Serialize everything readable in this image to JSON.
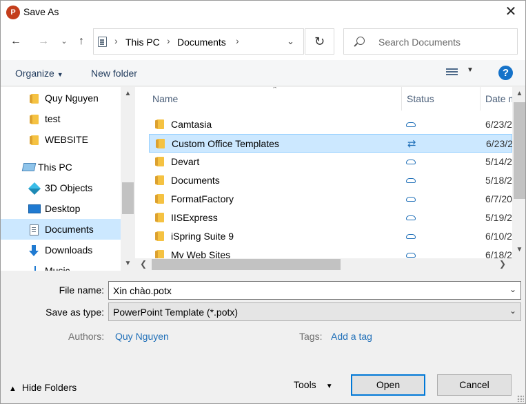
{
  "window": {
    "app_icon_letter": "P",
    "title": "Save As",
    "close_glyph": "✕"
  },
  "address": {
    "crumbs": [
      "This PC",
      "Documents"
    ],
    "search_placeholder": "Search Documents"
  },
  "toolbar": {
    "organize": "Organize",
    "new_folder": "New folder",
    "help": "?"
  },
  "nav": {
    "items": [
      {
        "label": "Quy Nguyen",
        "icon": "folder-icon"
      },
      {
        "label": "test",
        "icon": "folder-icon"
      },
      {
        "label": "WEBSITE",
        "icon": "folder-icon"
      },
      {
        "label": "This PC",
        "icon": "this-pc-icon"
      },
      {
        "label": "3D Objects",
        "icon": "3d-objects-icon"
      },
      {
        "label": "Desktop",
        "icon": "desktop-icon"
      },
      {
        "label": "Documents",
        "icon": "documents-icon",
        "selected": true
      },
      {
        "label": "Downloads",
        "icon": "downloads-icon"
      },
      {
        "label": "Music",
        "icon": "music-icon"
      }
    ]
  },
  "files": {
    "columns": [
      "Name",
      "Status",
      "Date m"
    ],
    "rows": [
      {
        "name": "Camtasia",
        "status": "cloud-icon",
        "date": "6/23/2"
      },
      {
        "name": "Custom Office Templates",
        "status": "sync-icon",
        "date": "6/23/2",
        "selected": true
      },
      {
        "name": "Devart",
        "status": "cloud-icon",
        "date": "5/14/2"
      },
      {
        "name": "Documents",
        "status": "cloud-icon",
        "date": "5/18/2"
      },
      {
        "name": "FormatFactory",
        "status": "cloud-icon",
        "date": "6/7/20"
      },
      {
        "name": "IISExpress",
        "status": "cloud-icon",
        "date": "5/19/2"
      },
      {
        "name": "iSpring Suite 9",
        "status": "cloud-icon",
        "date": "6/10/2"
      },
      {
        "name": "My Web Sites",
        "status": "cloud-icon",
        "date": "6/18/2"
      }
    ]
  },
  "form": {
    "file_name_label": "File name:",
    "file_name_value": "Xin chào.potx",
    "save_type_label": "Save as type:",
    "save_type_value": "PowerPoint Template (*.potx)",
    "authors_label": "Authors:",
    "authors_value": "Quy Nguyen",
    "tags_label": "Tags:",
    "tags_value": "Add a tag"
  },
  "footer": {
    "hide_folders": "Hide Folders",
    "tools": "Tools",
    "open": "Open",
    "cancel": "Cancel"
  },
  "colors": {
    "accent": "#0078d7",
    "selection": "#cce8ff",
    "link": "#1f6fb8",
    "app_icon": "#c43e1c"
  }
}
